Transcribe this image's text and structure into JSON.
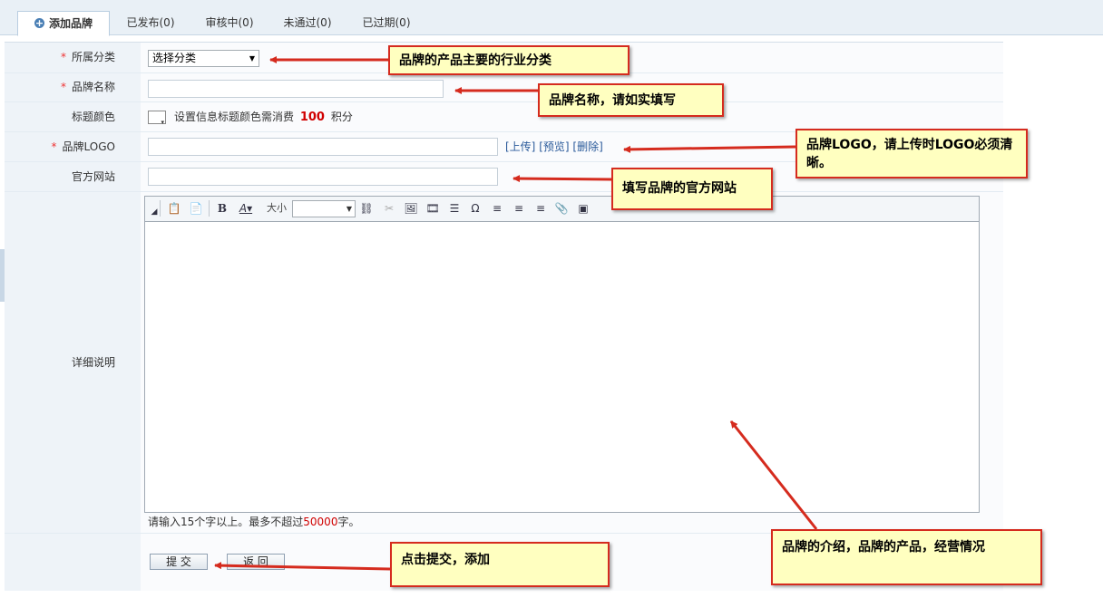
{
  "tabs": [
    {
      "label": "添加品牌",
      "active": true
    },
    {
      "label": "已发布(0)"
    },
    {
      "label": "审核中(0)"
    },
    {
      "label": "未通过(0)"
    },
    {
      "label": "已过期(0)"
    }
  ],
  "form": {
    "category_label": "所属分类",
    "category_value": "选择分类",
    "name_label": "品牌名称",
    "color_label": "标题颜色",
    "color_hint_prefix": "设置信息标题颜色需消费",
    "color_cost": "100",
    "color_hint_suffix": "积分",
    "logo_label": "品牌LOGO",
    "logo_upload": "[上传]",
    "logo_preview": "[预览]",
    "logo_delete": "[删除]",
    "website_label": "官方网站",
    "detail_label": "详细说明",
    "size_label": "大小",
    "word_hint_prefix": "请输入15个字以上。最多不超过",
    "word_limit": "50000",
    "word_hint_suffix": "字。",
    "submit_label": "提 交",
    "back_label": "返 回"
  },
  "annotations": {
    "category": "品牌的产品主要的行业分类",
    "name": "品牌名称，请如实填写",
    "logo": "品牌LOGO，请上传时LOGO必须清晰。",
    "website": "填写品牌的官方网站",
    "detail": "品牌的介绍，品牌的产品，经营情况",
    "submit": "点击提交，添加"
  },
  "colors": {
    "accent_red": "#d52b1e",
    "note_bg": "#ffffc0",
    "cost_red": "#d00000"
  }
}
